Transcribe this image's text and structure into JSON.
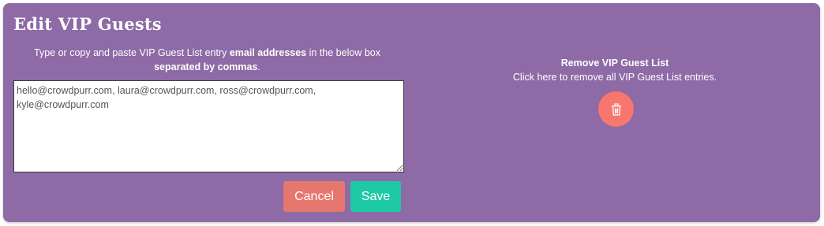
{
  "dialog": {
    "title": "Edit VIP Guests",
    "instructions": {
      "part1": "Type or copy and paste VIP Guest List entry ",
      "bold1": "email addresses",
      "part2": " in the below box ",
      "bold2": "separated by commas",
      "part3": "."
    },
    "emails_value": "hello@crowdpurr.com, laura@crowdpurr.com, ross@crowdpurr.com, kyle@crowdpurr.com",
    "cancel_label": "Cancel",
    "save_label": "Save"
  },
  "remove": {
    "title": "Remove VIP Guest List",
    "description": "Click here to remove all VIP Guest List entries.",
    "icon": "trash-icon"
  },
  "colors": {
    "panel_bg": "#8e6aa6",
    "cancel": "#e5776f",
    "save": "#1ec9a6",
    "trash": "#f7776e"
  }
}
